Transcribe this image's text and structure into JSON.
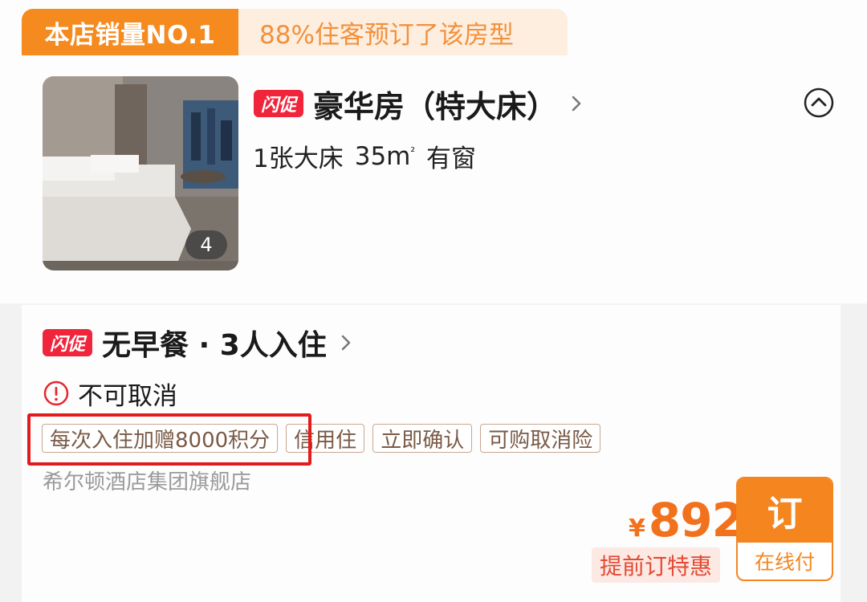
{
  "room": {
    "sales_badge": "本店销量NO.1",
    "booked_pct": "88%住客预订了该房型",
    "flash_badge": "闪促",
    "name": "豪华房（特大床）",
    "specs": {
      "bed": "1张大床",
      "area": "35m",
      "area_unit_sup": "²",
      "window": "有窗"
    },
    "photo_count": "4"
  },
  "rate": {
    "flash_badge": "闪促",
    "plan": "无早餐 · 3人入住",
    "policy": "不可取消",
    "tags": [
      "每次入住加赠8000积分",
      "信用住",
      "立即确认",
      "可购取消险"
    ],
    "store": "希尔顿酒店集团旗舰店",
    "price_currency": "¥",
    "price_value": "892",
    "promo": "提前订特惠",
    "book_label": "订",
    "pay_label": "在线付"
  },
  "colors": {
    "accent_orange": "#f58a1f",
    "flash_red": "#f0253b",
    "price_orange": "#f2711c",
    "highlight_box_red": "#e31b1b"
  },
  "icons": {
    "room_chevron": "chevron-right-icon",
    "collapse": "chevron-up-circle-icon",
    "plan_chevron": "chevron-right-icon",
    "policy": "alert-circle-icon"
  }
}
